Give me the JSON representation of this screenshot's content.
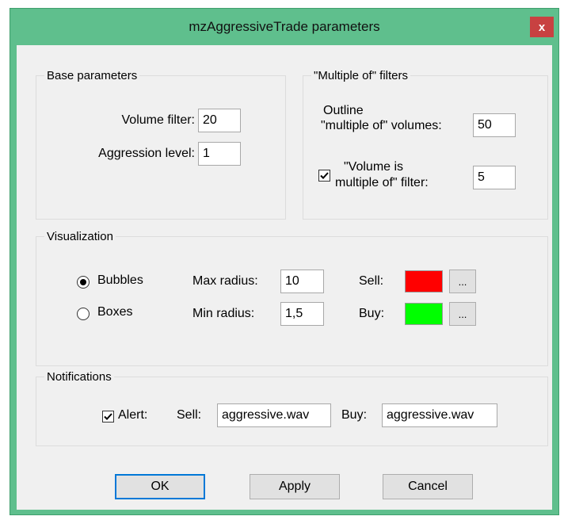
{
  "window": {
    "title": "mzAggressiveTrade parameters",
    "close_label": "x"
  },
  "base": {
    "legend": "Base parameters",
    "volume_label": "Volume filter:",
    "volume_value": "20",
    "aggression_label": "Aggression level:",
    "aggression_value": "1"
  },
  "multiple": {
    "legend": "\"Multiple of\" filters",
    "outline_label_line1": "Outline",
    "outline_label_line2": "\"multiple of\" volumes:",
    "outline_value": "50",
    "filter_checked": true,
    "filter_label_line1": "\"Volume is",
    "filter_label_line2": "multiple of\" filter:",
    "filter_value": "5"
  },
  "visualization": {
    "legend": "Visualization",
    "bubbles_label": "Bubbles",
    "boxes_label": "Boxes",
    "selected": "Bubbles",
    "max_radius_label": "Max radius:",
    "max_radius_value": "10",
    "min_radius_label": "Min radius:",
    "min_radius_value": "1,5",
    "sell_label": "Sell:",
    "sell_color": "#ff0000",
    "buy_label": "Buy:",
    "buy_color": "#00ff00",
    "pick_label": "..."
  },
  "notifications": {
    "legend": "Notifications",
    "alert_checked": true,
    "alert_label": "Alert:",
    "sell_label": "Sell:",
    "sell_value": "aggressive.wav",
    "buy_label": "Buy:",
    "buy_value": "aggressive.wav"
  },
  "buttons": {
    "ok": "OK",
    "apply": "Apply",
    "cancel": "Cancel"
  }
}
